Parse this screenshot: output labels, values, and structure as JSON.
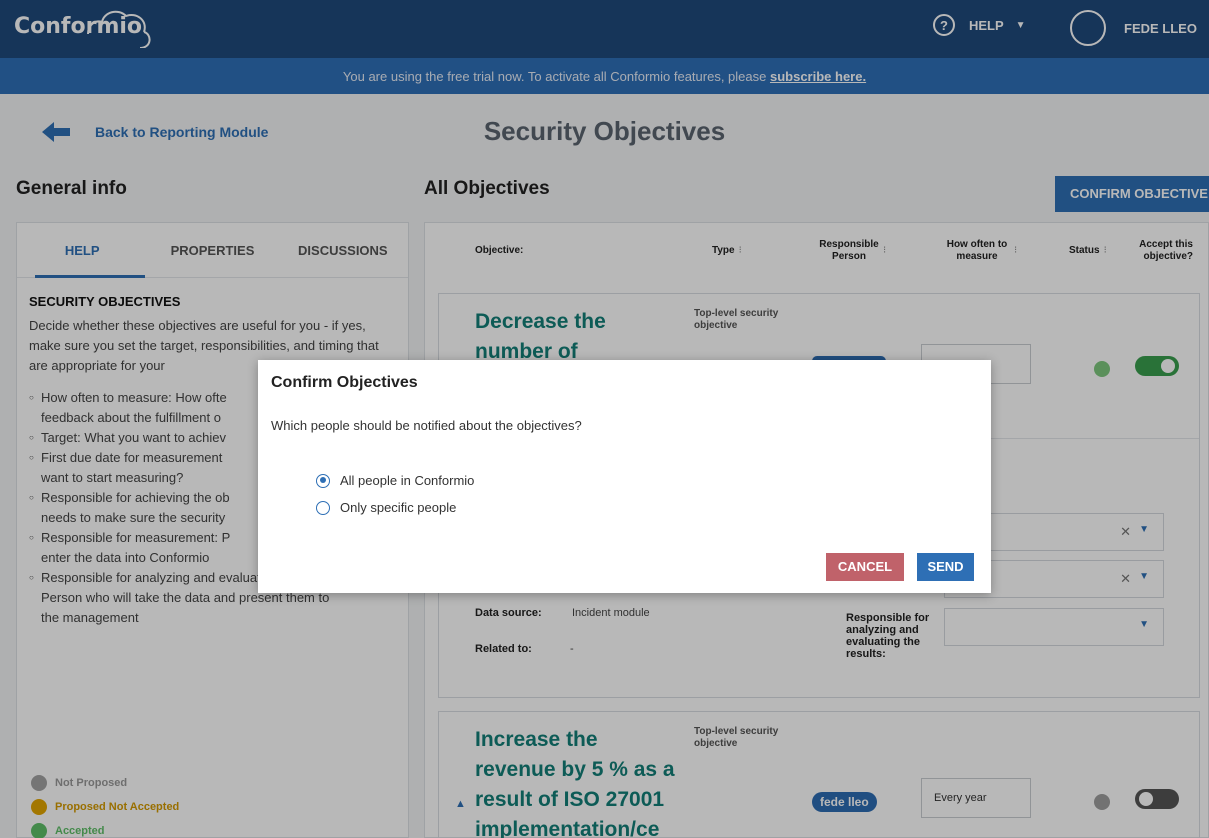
{
  "app": {
    "logo": "Conformio",
    "help_label": "HELP",
    "user_name": "FEDE LLEO"
  },
  "trial_banner": {
    "text": "You are using the free trial now. To activate all Conformio features, please ",
    "link": "subscribe here."
  },
  "nav": {
    "back_label": "Back to Reporting Module"
  },
  "page": {
    "title": "Security Objectives"
  },
  "left": {
    "heading": "General info",
    "tabs": [
      "HELP",
      "PROPERTIES",
      "DISCUSSIONS"
    ],
    "help_title": "SECURITY OBJECTIVES",
    "help_intro": "Decide whether these objectives are useful for you - if yes, make sure you set the target, responsibilities, and timing that are appropriate for your",
    "help_items": [
      "How often to measure: How ofte",
      "feedback about the fulfillment o",
      "Target: What you want to achiev",
      "First due date for measurement",
      "want to start measuring?",
      "Responsible for achieving the ob",
      "needs to make sure the security",
      "Responsible for measurement: P",
      "enter the data into Conformio",
      "Responsible for analyzing and evaluating the results:",
      "Person who will take the data and present them to",
      "the management"
    ],
    "legend": [
      {
        "label": "Not Proposed",
        "color": "#a3a3a3"
      },
      {
        "label": "Proposed Not Accepted",
        "color": "#e2a500"
      },
      {
        "label": "Accepted",
        "color": "#5fbf68"
      }
    ]
  },
  "right": {
    "heading": "All Objectives",
    "confirm_button": "CONFIRM OBJECTIVE",
    "columns": {
      "objective": "Objective:",
      "type": "Type",
      "responsible": "Responsible Person",
      "how_often": "How often to measure",
      "status": "Status",
      "accept": "Accept this objective?"
    },
    "rows": [
      {
        "title_line1": "Decrease the",
        "title_line2": "number of",
        "type": "Top-level security objective",
        "accepted": true,
        "status_color": "#7ec87e",
        "data_source_label": "Data source:",
        "data_source_value": "Incident module",
        "related_label": "Related to:",
        "related_value": "-",
        "sel1_text": "o",
        "sel2_text": "o",
        "analysis_label": "Responsible for analyzing and evaluating the results:"
      },
      {
        "title_lines": [
          "Increase the",
          "revenue by 5 % as a",
          "result of ISO 27001",
          "implementation/ce"
        ],
        "type": "Top-level security objective",
        "responsible": "fede lleo",
        "how_often": "Every year",
        "accepted": false,
        "status_color": "#9e9e9e"
      }
    ]
  },
  "modal": {
    "title": "Confirm Objectives",
    "question": "Which people should be notified about the objectives?",
    "options": [
      "All people in Conformio",
      "Only specific people"
    ],
    "selected": 0,
    "cancel": "CANCEL",
    "send": "SEND"
  },
  "colors": {
    "header": "#1f4a7c",
    "banner": "#2f6fb8",
    "accent": "#2e6fb5",
    "objective_title": "#127f78",
    "cancel": "#c0626a"
  }
}
